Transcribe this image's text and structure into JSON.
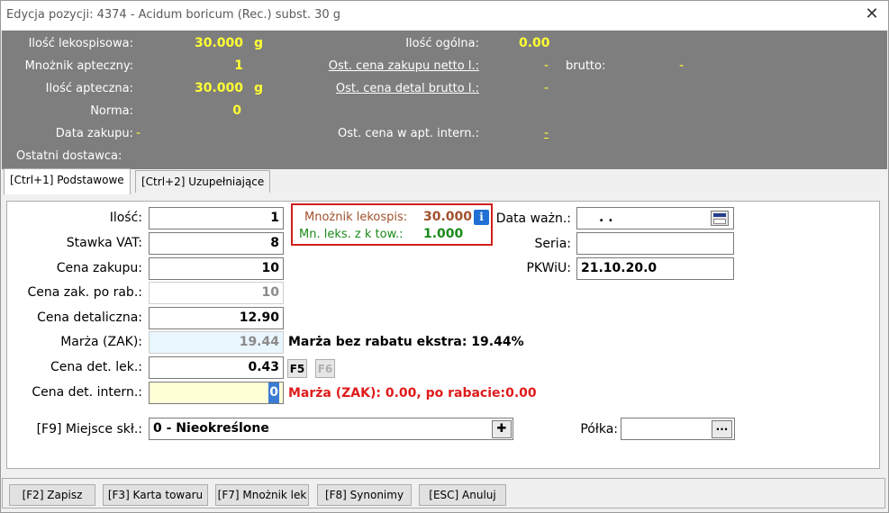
{
  "window": {
    "title": "Edycja pozycji: 4374 - Acidum boricum (Rec.) subst. 30 g",
    "close_glyph": "✕"
  },
  "info": {
    "ilosc_lekospisowa": {
      "label": "Ilość lekospisowa:",
      "value": "30.000",
      "unit": "g"
    },
    "mnoznik_apteczny": {
      "label": "Mnożnik apteczny:",
      "value": "1"
    },
    "ilosc_apteczna": {
      "label": "Ilość apteczna:",
      "value": "30.000",
      "unit": "g"
    },
    "norma": {
      "label": "Norma:",
      "value": "0"
    },
    "data_zakupu": {
      "label": "Data zakupu:",
      "value": "-"
    },
    "ostatni_dostawca": {
      "label": "Ostatni dostawca:"
    },
    "ilosc_ogolna": {
      "label": "Ilość ogólna:",
      "value": "0.00"
    },
    "ost_cena_zakupu": {
      "label": "Ost. cena zakupu netto l.:",
      "value": "-"
    },
    "brutto": {
      "label": "brutto:",
      "value": "-"
    },
    "ost_cena_detal": {
      "label": "Ost. cena detal brutto l.:",
      "value": "-"
    },
    "ost_cena_apt": {
      "label": "Ost. cena w apt. intern.:",
      "value": "-"
    }
  },
  "tabs": [
    {
      "label": "[Ctrl+1] Podstawowe",
      "active": true
    },
    {
      "label": "[Ctrl+2] Uzupełniające",
      "active": false
    }
  ],
  "form": {
    "ilosc": {
      "label": "Ilość:",
      "value": "1"
    },
    "stawka_vat": {
      "label": "Stawka VAT:",
      "value": "8"
    },
    "cena_zakupu": {
      "label": "Cena zakupu:",
      "value": "10"
    },
    "cena_zak_po_rab": {
      "label": "Cena zak. po rab.:",
      "value": "10"
    },
    "cena_detaliczna": {
      "label": "Cena detaliczna:",
      "value": "12.90"
    },
    "marza_zak": {
      "label": "Marża (ZAK):",
      "value": "19.44"
    },
    "cena_det_lek": {
      "label": "Cena det. lek.:",
      "value": "0.43"
    },
    "cena_det_intern": {
      "label": "Cena det. intern.:",
      "value": "0"
    },
    "miejsce_skl": {
      "label": "[F9] Miejsce skł.:",
      "value": "0 - Nieokreślone"
    },
    "polka": {
      "label": "Półka:",
      "value": ""
    },
    "data_wazn": {
      "label": "Data ważn.:",
      "value": ". ."
    },
    "seria": {
      "label": "Seria:",
      "value": ""
    },
    "pkwiu": {
      "label": "PKWiU:",
      "value": "21.10.20.0"
    }
  },
  "mnoznik_box": {
    "line1_label": "Mnożnik lekospis:",
    "line1_value": "30.000",
    "line2_label": "Mn. leks. z k tow.:",
    "line2_value": "1.000",
    "info_glyph": "i"
  },
  "messages": {
    "marza_bez_rabatu": "Marża bez rabatu ekstra: 19.44%",
    "marza_zak_red": "Marża (ZAK): 0.00, po rabacie:0.00"
  },
  "small_buttons": {
    "f5": "F5",
    "f6": "F6"
  },
  "icons": {
    "plus_glyph": "✚",
    "dots_glyph": "···"
  },
  "bottom_buttons": [
    {
      "label": "[F2] Zapisz"
    },
    {
      "label": "[F3] Karta towaru"
    },
    {
      "label": "[F7] Mnożnik lek"
    },
    {
      "label": "[F8] Synonimy"
    },
    {
      "label": "[ESC] Anuluj"
    }
  ],
  "colors": {
    "info_panel_bg": "#7e7e7e",
    "info_value_yellow": "#ffff33",
    "highlight_red": "#d21e1e",
    "green_value": "#1a8a1a",
    "brown_value": "#a0522d"
  }
}
